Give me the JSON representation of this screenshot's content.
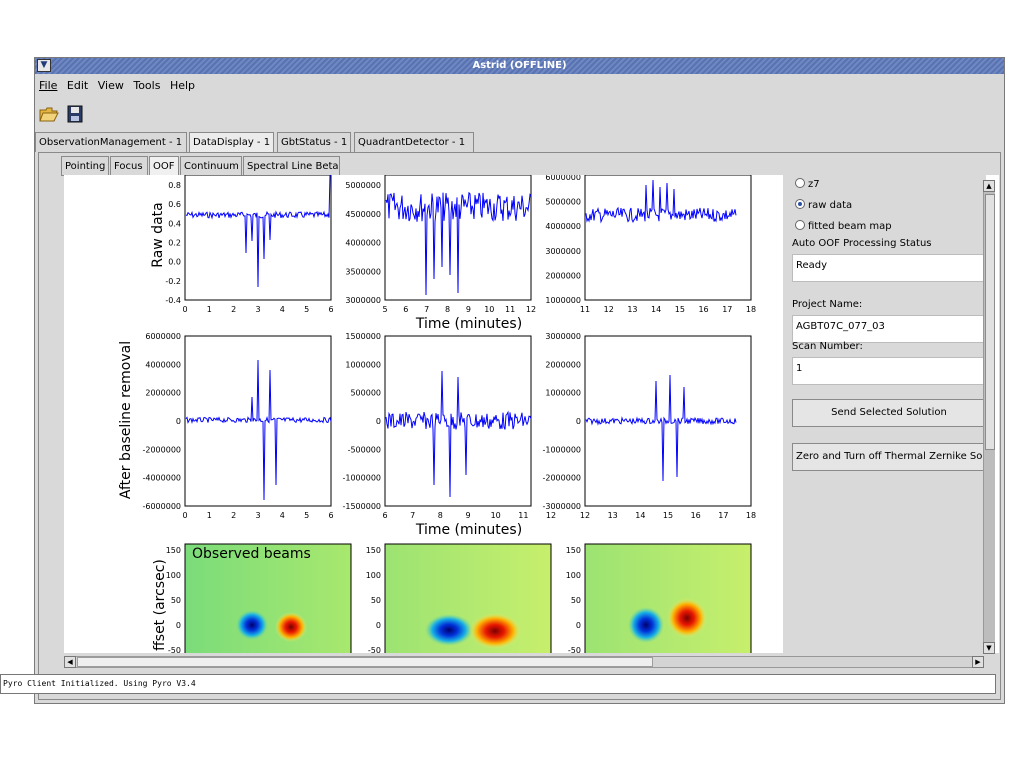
{
  "window": {
    "title": "Astrid (OFFLINE)"
  },
  "menu": [
    "File",
    "Edit",
    "View",
    "Tools",
    "Help"
  ],
  "toolbar": {
    "open_icon": "folder-open-icon",
    "save_icon": "floppy-disk-icon"
  },
  "tabs": [
    "ObservationManagement - 1",
    "DataDisplay - 1",
    "GbtStatus - 1",
    "QuadrantDetector - 1"
  ],
  "subtabs": [
    "Pointing",
    "Focus",
    "OOF",
    "Continuum",
    "Spectral Line Beta"
  ],
  "plots": {
    "row1_ylabel": "Raw data",
    "row2_ylabel": "After baseline removal",
    "row3_ylabel": "ffset (arcsec)",
    "xlabel": "Time (minutes)",
    "annotation": "Observed beams",
    "row1_ticks": {
      "p1_y": [
        "0.8",
        "0.6",
        "0.4",
        "0.2",
        "0.0",
        "-0.2",
        "-0.4"
      ],
      "p2_y": [
        "5000000",
        "4500000",
        "4000000",
        "3500000",
        "3000000"
      ],
      "p3_y": [
        "6000000",
        "5000000",
        "4000000",
        "3000000",
        "2000000",
        "1000000"
      ],
      "p1_x": [
        "0",
        "1",
        "2",
        "3",
        "4",
        "5",
        "6"
      ],
      "p2_x": [
        "5",
        "6",
        "7",
        "8",
        "9",
        "10",
        "11",
        "12"
      ],
      "p3_x": [
        "11",
        "12",
        "13",
        "14",
        "15",
        "16",
        "17",
        "18"
      ]
    },
    "row2_ticks": {
      "p1_y": [
        "6000000",
        "4000000",
        "2000000",
        "0",
        "-2000000",
        "-4000000",
        "-6000000"
      ],
      "p2_y": [
        "1500000",
        "1000000",
        "500000",
        "0",
        "-500000",
        "-1000000",
        "-1500000"
      ],
      "p3_y": [
        "3000000",
        "2000000",
        "1000000",
        "0",
        "-1000000",
        "-2000000",
        "-3000000"
      ],
      "p1_x": [
        "0",
        "1",
        "2",
        "3",
        "4",
        "5",
        "6"
      ],
      "p2_x": [
        "6",
        "7",
        "8",
        "9",
        "10",
        "11",
        "12"
      ],
      "p3_x": [
        "12",
        "13",
        "14",
        "15",
        "16",
        "17",
        "18"
      ]
    },
    "row3_ticks": {
      "y": [
        "150",
        "100",
        "50",
        "0",
        "-50"
      ]
    }
  },
  "right_panel": {
    "radio_z7": "z7",
    "radio_raw": "raw data",
    "radio_fitted": "fitted beam map",
    "selected_radio": "raw data",
    "status_label": "Auto OOF Processing Status",
    "status_value": "Ready",
    "project_label": "Project Name:",
    "project_value": "AGBT07C_077_03",
    "scan_label": "Scan Number:",
    "scan_value": "1",
    "send_button": "Send Selected Solution",
    "zero_button": "Zero and Turn off Thermal Zernike So"
  },
  "log": "Pyro Client Initialized. Using Pyro V3.4",
  "colors": {
    "titlebar": "#6f88c2",
    "trace": "#0000ff",
    "panel_bg": "#d9d9d9"
  }
}
